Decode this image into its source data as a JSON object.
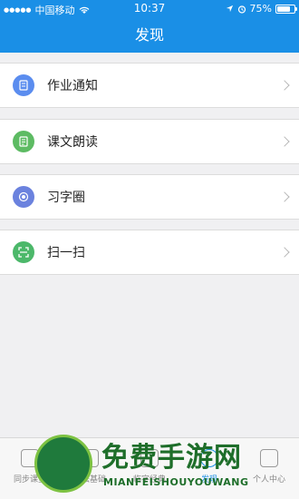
{
  "status": {
    "carrier": "中国移动",
    "time": "10:37",
    "battery_percent": "75%",
    "battery_level": 0.75
  },
  "header": {
    "title": "发现"
  },
  "items": [
    {
      "label": "作业通知",
      "icon": "notification-icon",
      "color": "#5b8def"
    },
    {
      "label": "课文朗读",
      "icon": "reading-icon",
      "color": "#5dbb63"
    },
    {
      "label": "习字圈",
      "icon": "circle-icon",
      "color": "#6b82de"
    },
    {
      "label": "扫一扫",
      "icon": "scan-icon",
      "color": "#4cb86a"
    }
  ],
  "tabs": [
    {
      "label": "同步课堂",
      "active": false
    },
    {
      "label": "书法基础",
      "active": false
    },
    {
      "label": "临字经典",
      "active": false
    },
    {
      "label": "发现",
      "active": true
    },
    {
      "label": "个人中心",
      "active": false
    }
  ],
  "watermark": {
    "title": "免费手游网",
    "subtitle": "MIANFEISHOUYOUWANG"
  },
  "colors": {
    "primary": "#1a8fe6",
    "background": "#f0f0f2"
  }
}
